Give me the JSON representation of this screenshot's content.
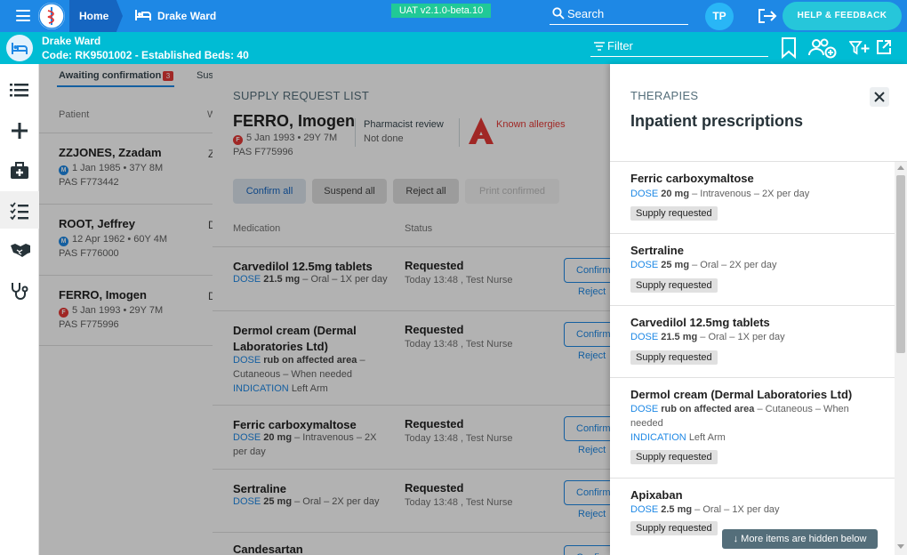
{
  "topbar": {
    "home": "Home",
    "ward": "Drake Ward",
    "version": "UAT v2.1.0-beta.10",
    "search_placeholder": "Search",
    "avatar": "TP",
    "help": "HELP & FEEDBACK"
  },
  "wardbar": {
    "name": "Drake Ward",
    "code": "Code: RK9501002 - Established Beds: 40",
    "filter": "Filter"
  },
  "base": {
    "tab_await": "Awaiting confirmation",
    "tab_await_count": "3",
    "tab_sus": "Sus",
    "col_patient": "Patient",
    "col_w": "W",
    "patients": [
      {
        "name": "ZZJONES, Zzadam",
        "gender": "M",
        "dob": "1 Jan 1985 • 37Y 8M",
        "pas": "PAS F773442",
        "extra": "Z"
      },
      {
        "name": "ROOT, Jeffrey",
        "gender": "M",
        "dob": "12 Apr 1962 • 60Y 4M",
        "pas": "PAS F776000",
        "extra": "D"
      },
      {
        "name": "FERRO, Imogen",
        "gender": "F",
        "dob": "5 Jan 1993 • 29Y 7M",
        "pas": "PAS F775996",
        "extra": "D"
      }
    ]
  },
  "supply": {
    "title": "SUPPLY REQUEST LIST",
    "patient_name": "FERRO, Imogen",
    "patient_gender": "F",
    "patient_dob": "5 Jan 1993 • 29Y 7M",
    "patient_pas": "PAS F775996",
    "pharm_label": "Pharmacist review",
    "pharm_value": "Not done",
    "allergies": "Known allergies",
    "btn_confirm_all": "Confirm all",
    "btn_suspend_all": "Suspend all",
    "btn_reject_all": "Reject all",
    "btn_print": "Print confirmed",
    "col_med": "Medication",
    "col_status": "Status",
    "confirm": "Confirm",
    "reject": "Reject",
    "meds": [
      {
        "name": "Carvedilol 12.5mg tablets",
        "dose_label": "DOSE",
        "dose": "21.5 mg",
        "route": " – Oral – 1X per day",
        "indication_label": "",
        "indication": "",
        "status": "Requested",
        "time": "Today 13:48 , Test Nurse"
      },
      {
        "name": "Dermol cream (Dermal Laboratories Ltd)",
        "dose_label": "DOSE",
        "dose": "rub on affected area",
        "route": " – Cutaneous – When needed",
        "indication_label": "INDICATION",
        "indication": "Left Arm",
        "status": "Requested",
        "time": "Today 13:48 , Test Nurse"
      },
      {
        "name": "Ferric carboxymaltose",
        "dose_label": "DOSE",
        "dose": "20 mg",
        "route": " – Intravenous – 2X per day",
        "indication_label": "",
        "indication": "",
        "status": "Requested",
        "time": "Today 13:48 , Test Nurse"
      },
      {
        "name": "Sertraline",
        "dose_label": "DOSE",
        "dose": "25 mg",
        "route": " – Oral – 2X per day",
        "indication_label": "",
        "indication": "",
        "status": "Requested",
        "time": "Today 13:48 , Test Nurse"
      },
      {
        "name": "Candesartan",
        "dose_label": "",
        "dose": "",
        "route": "",
        "indication_label": "",
        "indication": "",
        "status": "",
        "time": ""
      }
    ]
  },
  "therapies": {
    "title": "THERAPIES",
    "subtitle": "Inpatient prescriptions",
    "chip": "Supply requested",
    "hidden_note": "More items are hidden below",
    "items": [
      {
        "name": "Ferric carboxymaltose",
        "dose_label": "DOSE",
        "dose": "20 mg",
        "route": " – Intravenous – 2X per day",
        "indication_label": "",
        "indication": ""
      },
      {
        "name": "Sertraline",
        "dose_label": "DOSE",
        "dose": "25 mg",
        "route": " – Oral – 2X per day",
        "indication_label": "",
        "indication": ""
      },
      {
        "name": "Carvedilol 12.5mg tablets",
        "dose_label": "DOSE",
        "dose": "21.5 mg",
        "route": " – Oral – 1X per day",
        "indication_label": "",
        "indication": ""
      },
      {
        "name": "Dermol cream (Dermal Laboratories Ltd)",
        "dose_label": "DOSE",
        "dose": "rub on affected area",
        "route": " – Cutaneous – When needed",
        "indication_label": "INDICATION",
        "indication": "Left Arm"
      },
      {
        "name": "Apixaban",
        "dose_label": "DOSE",
        "dose": "2.5 mg",
        "route": " – Oral – 1X per day",
        "indication_label": "",
        "indication": ""
      }
    ]
  },
  "colors": {
    "primary": "#1e88e5",
    "ward_bar": "#00bcd4",
    "allergy": "#e53935",
    "version": "#20c997"
  },
  "icons": [
    "menu-icon",
    "bed-icon",
    "search-icon",
    "logout-icon",
    "bookmark-icon",
    "add-user-icon",
    "filter-add-icon",
    "open-external-icon",
    "list-icon",
    "plus-icon",
    "medical-bag-icon",
    "checklist-icon",
    "handshake-icon",
    "stethoscope-icon",
    "close-icon",
    "arrow-down-icon"
  ]
}
